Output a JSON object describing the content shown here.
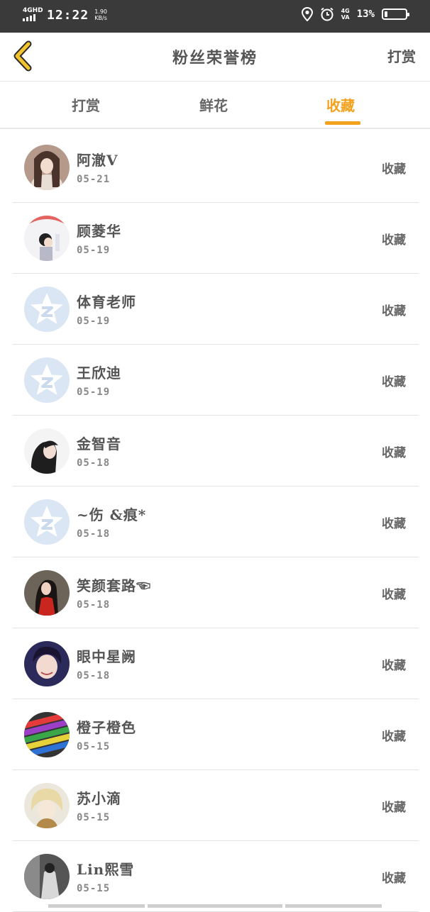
{
  "status_bar": {
    "network_left": "4GHD",
    "time": "12:22",
    "speed_value": "1.90",
    "speed_unit": "KB/s",
    "network_right_top": "4G",
    "network_right_bottom": "VA",
    "battery_percent": "13%",
    "battery_level": 0.13,
    "icons": [
      "location-icon",
      "alarm-icon"
    ]
  },
  "header": {
    "title": "粉丝荣誉榜",
    "action_label": "打赏",
    "back_icon": "chevron-left-icon",
    "accent_color": "#f2a21c"
  },
  "tabs": [
    {
      "label": "打赏",
      "active": false
    },
    {
      "label": "鲜花",
      "active": false
    },
    {
      "label": "收藏",
      "active": true
    }
  ],
  "fans": [
    {
      "name": "阿澈V",
      "date": "05-21",
      "action": "收藏",
      "avatar": "photo-avatar"
    },
    {
      "name": "顾菱华",
      "date": "05-19",
      "action": "收藏",
      "avatar": "photo-avatar"
    },
    {
      "name": "体育老师",
      "date": "05-19",
      "action": "收藏",
      "avatar": "default-star-avatar"
    },
    {
      "name": "王欣迪",
      "date": "05-19",
      "action": "收藏",
      "avatar": "default-star-avatar"
    },
    {
      "name": "金智音",
      "date": "05-18",
      "action": "收藏",
      "avatar": "photo-avatar"
    },
    {
      "name": "~伤 &痕*",
      "date": "05-18",
      "action": "收藏",
      "avatar": "default-star-avatar"
    },
    {
      "name": "笑颜套路☜",
      "date": "05-18",
      "action": "收藏",
      "avatar": "photo-avatar"
    },
    {
      "name": "眼中星阙",
      "date": "05-18",
      "action": "收藏",
      "avatar": "photo-avatar"
    },
    {
      "name": "橙子橙色",
      "date": "05-15",
      "action": "收藏",
      "avatar": "photo-avatar"
    },
    {
      "name": "苏小滴",
      "date": "05-15",
      "action": "收藏",
      "avatar": "photo-avatar"
    },
    {
      "name": "Lin熙雪",
      "date": "05-15",
      "action": "收藏",
      "avatar": "photo-avatar"
    }
  ]
}
